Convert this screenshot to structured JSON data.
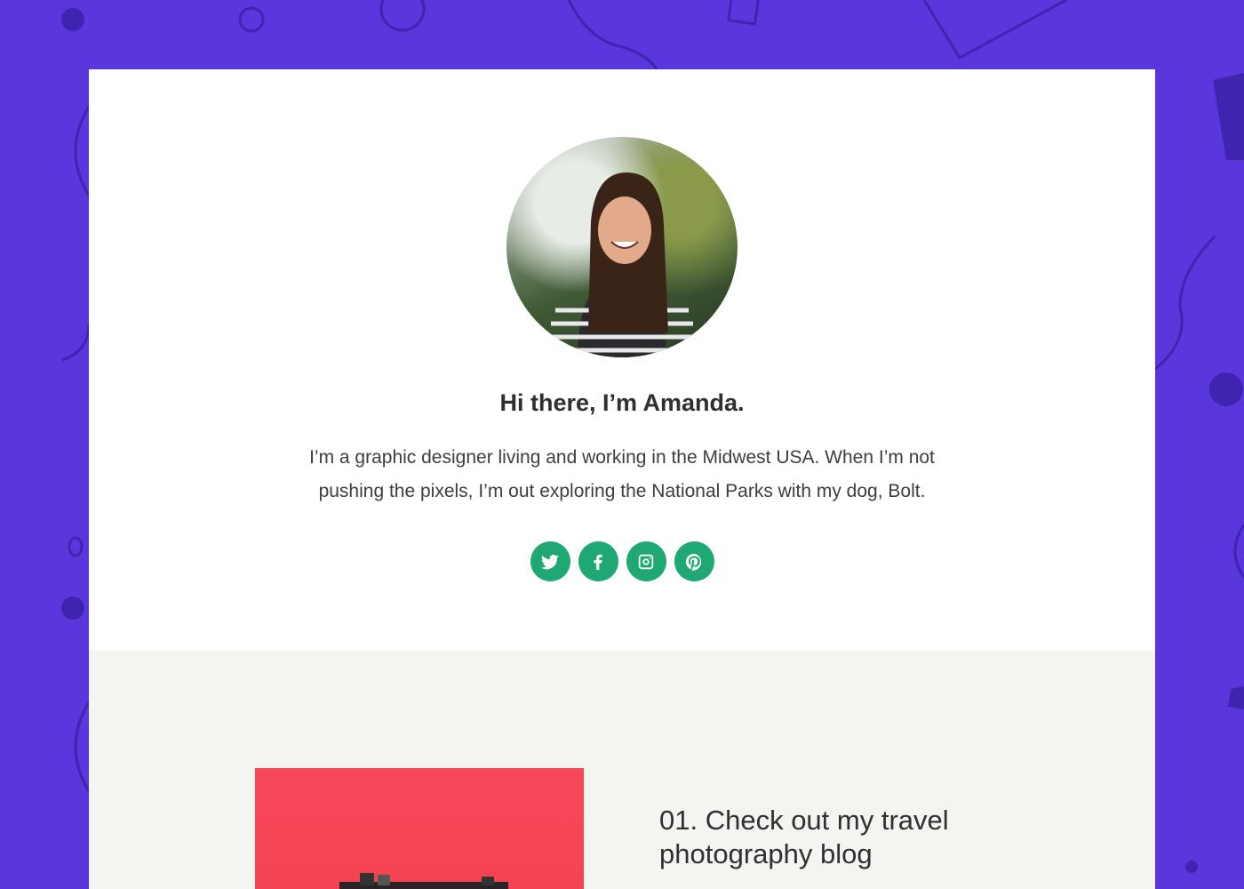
{
  "profile": {
    "heading": "Hi there, I’m Amanda.",
    "bio": "I’m a graphic designer living and working in the Midwest USA. When I’m not pushing the pixels, I’m out exploring the National Parks with my dog, Bolt."
  },
  "socials": [
    {
      "icon": "twitter-icon"
    },
    {
      "icon": "facebook-icon"
    },
    {
      "icon": "instagram-icon"
    },
    {
      "icon": "pinterest-icon"
    }
  ],
  "links": [
    {
      "title": "01. Check out my travel photography blog"
    }
  ],
  "colors": {
    "background": "#5a37dc",
    "accent": "#1fa873",
    "section": "#f4f4f0"
  }
}
